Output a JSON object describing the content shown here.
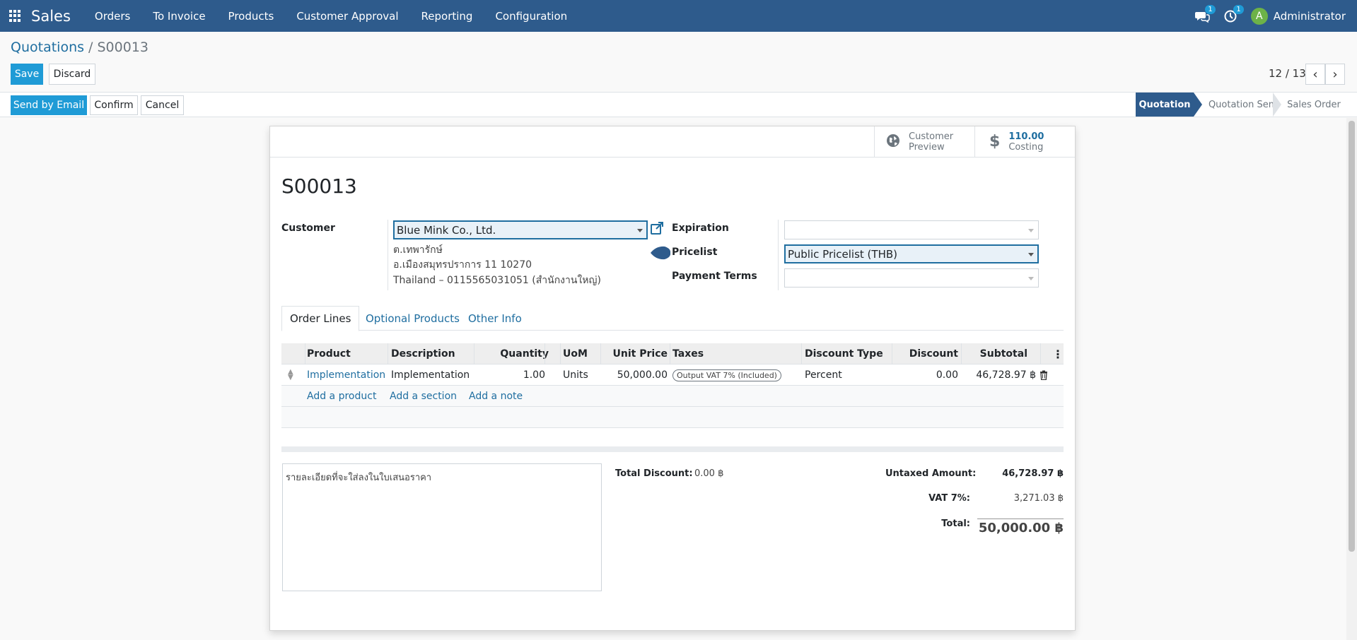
{
  "navbar": {
    "app_name": "Sales",
    "menu": [
      "Orders",
      "To Invoice",
      "Products",
      "Customer Approval",
      "Reporting",
      "Configuration"
    ],
    "messages_badge": "1",
    "activities_badge": "1",
    "user_initial": "A",
    "user_name": "Administrator"
  },
  "breadcrumb": {
    "parent": "Quotations",
    "separator": " / ",
    "current": "S00013"
  },
  "buttons": {
    "save": "Save",
    "discard": "Discard",
    "send_email": "Send by Email",
    "confirm": "Confirm",
    "cancel": "Cancel"
  },
  "pager": {
    "value": "12 / 13"
  },
  "status_stages": [
    "Quotation",
    "Quotation Sent",
    "Sales Order"
  ],
  "smart_buttons": {
    "preview_line1": "Customer",
    "preview_line2": "Preview",
    "costing_value": "110.00",
    "costing_label": "Costing"
  },
  "form": {
    "title": "S00013",
    "customer_label": "Customer",
    "customer_value": "Blue Mink Co., Ltd.",
    "address_line1": "ต.เทพารักษ์",
    "address_line2": "อ.เมืองสมุทรปราการ 11 10270",
    "address_line3": "Thailand – 0115565031051 (สำนักงานใหญ่)",
    "expiration_label": "Expiration",
    "expiration_value": "",
    "pricelist_label": "Pricelist",
    "pricelist_value": "Public Pricelist (THB)",
    "payment_terms_label": "Payment Terms",
    "payment_terms_value": ""
  },
  "tabs": [
    "Order Lines",
    "Optional Products",
    "Other Info"
  ],
  "table": {
    "headers": [
      "Product",
      "Description",
      "Quantity",
      "UoM",
      "Unit Price",
      "Taxes",
      "Discount Type",
      "Discount",
      "Subtotal"
    ],
    "row": {
      "product": "Implementation",
      "description": "Implementation",
      "quantity": "1.00",
      "uom": "Units",
      "unit_price": "50,000.00",
      "tax": "Output VAT 7% (Included)",
      "discount_type": "Percent",
      "discount": "0.00",
      "subtotal": "46,728.97 ฿"
    },
    "add_product": "Add a product",
    "add_section": "Add a section",
    "add_note": "Add a note"
  },
  "note": "รายละเอียดที่จะใส่ลงในใบเสนอราคา",
  "totals": {
    "total_discount_label": "Total Discount:",
    "total_discount_value": "0.00 ฿",
    "untaxed_label": "Untaxed Amount:",
    "untaxed_value": "46,728.97 ฿",
    "vat_label": "VAT 7%:",
    "vat_value": "3,271.03 ฿",
    "total_label": "Total:",
    "total_value": "50,000.00 ฿"
  }
}
